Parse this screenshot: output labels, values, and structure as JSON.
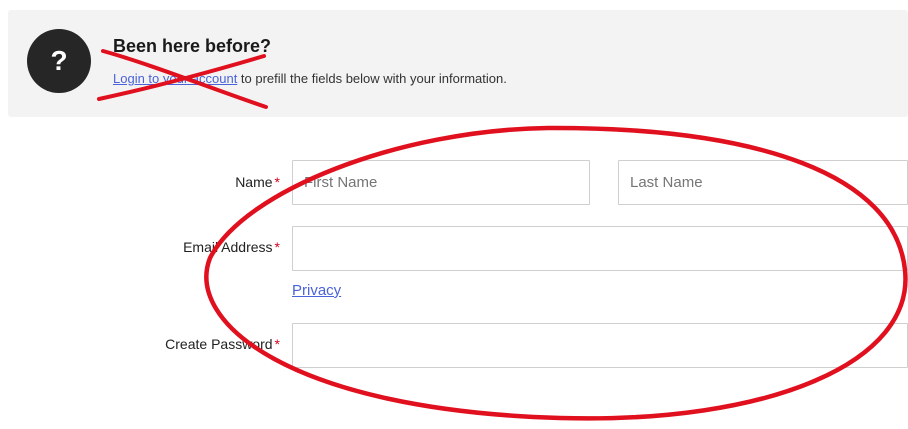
{
  "banner": {
    "icon": "help-icon",
    "icon_glyph": "?",
    "title": "Been here before?",
    "login_link": "Login to your account",
    "text_after_link": " to prefill the fields below with your information."
  },
  "form": {
    "name_label": "Name",
    "first_name_placeholder": "First Name",
    "last_name_placeholder": "Last Name",
    "email_label": "Email Address",
    "email_value": "",
    "privacy_link": "Privacy",
    "password_label": "Create Password",
    "password_value": "",
    "required_marker": "*"
  },
  "annotation": {
    "color": "#e0101e",
    "shapes": [
      "cross-out-mark",
      "ellipse-highlight"
    ]
  }
}
